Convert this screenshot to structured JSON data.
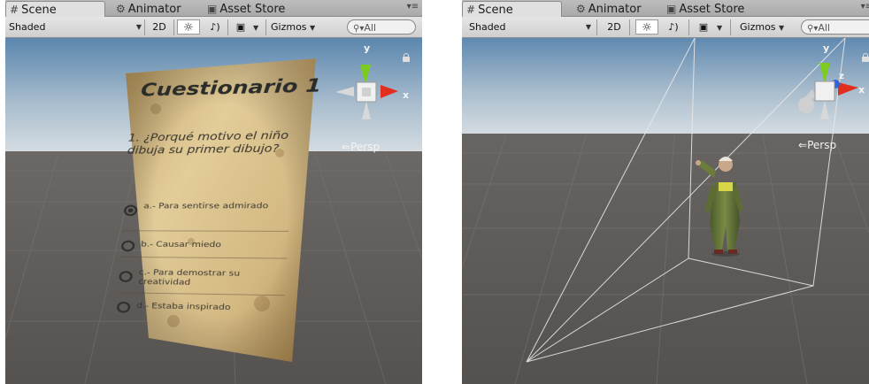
{
  "left_panel": {
    "tabs": [
      {
        "label": "Scene",
        "icon": "grid-icon"
      },
      {
        "label": "Animator",
        "icon": "animator-icon"
      },
      {
        "label": "Asset Store",
        "icon": "store-icon"
      }
    ],
    "toolbar": {
      "shading_mode": "Shaded",
      "mode_2d": "2D",
      "gizmos": "Gizmos",
      "search_placeholder": "All"
    },
    "viewport": {
      "persp_label": "Persp",
      "axis_x": "x",
      "axis_y": "y",
      "quiz": {
        "title": "Cuestionario 1",
        "question": "1. ¿Porqué motivo el niño dibuja su primer dibujo?",
        "options": [
          {
            "label": "a.- Para sentirse admirado",
            "selected": true
          },
          {
            "label": "b.- Causar miedo",
            "selected": false
          },
          {
            "label": "c.- Para demostrar su creatividad",
            "selected": false
          },
          {
            "label": "d.- Estaba inspirado",
            "selected": false
          }
        ]
      }
    }
  },
  "right_panel": {
    "tabs": [
      {
        "label": "Scene",
        "icon": "grid-icon"
      },
      {
        "label": "Animator",
        "icon": "animator-icon"
      },
      {
        "label": "Asset Store",
        "icon": "store-icon"
      }
    ],
    "toolbar": {
      "shading_mode": "Shaded",
      "mode_2d": "2D",
      "gizmos": "Gizmos",
      "search_placeholder": "All"
    },
    "viewport": {
      "persp_label": "Persp",
      "axis_x": "x",
      "axis_y": "y",
      "axis_z": "z"
    }
  },
  "colors": {
    "sky_top": "#5f89b0",
    "sky_horizon": "#d3dadf",
    "ground": "#5a5754",
    "axis_x": "#e02e1f",
    "axis_y": "#7ecb1f",
    "axis_z": "#2d64d8"
  }
}
